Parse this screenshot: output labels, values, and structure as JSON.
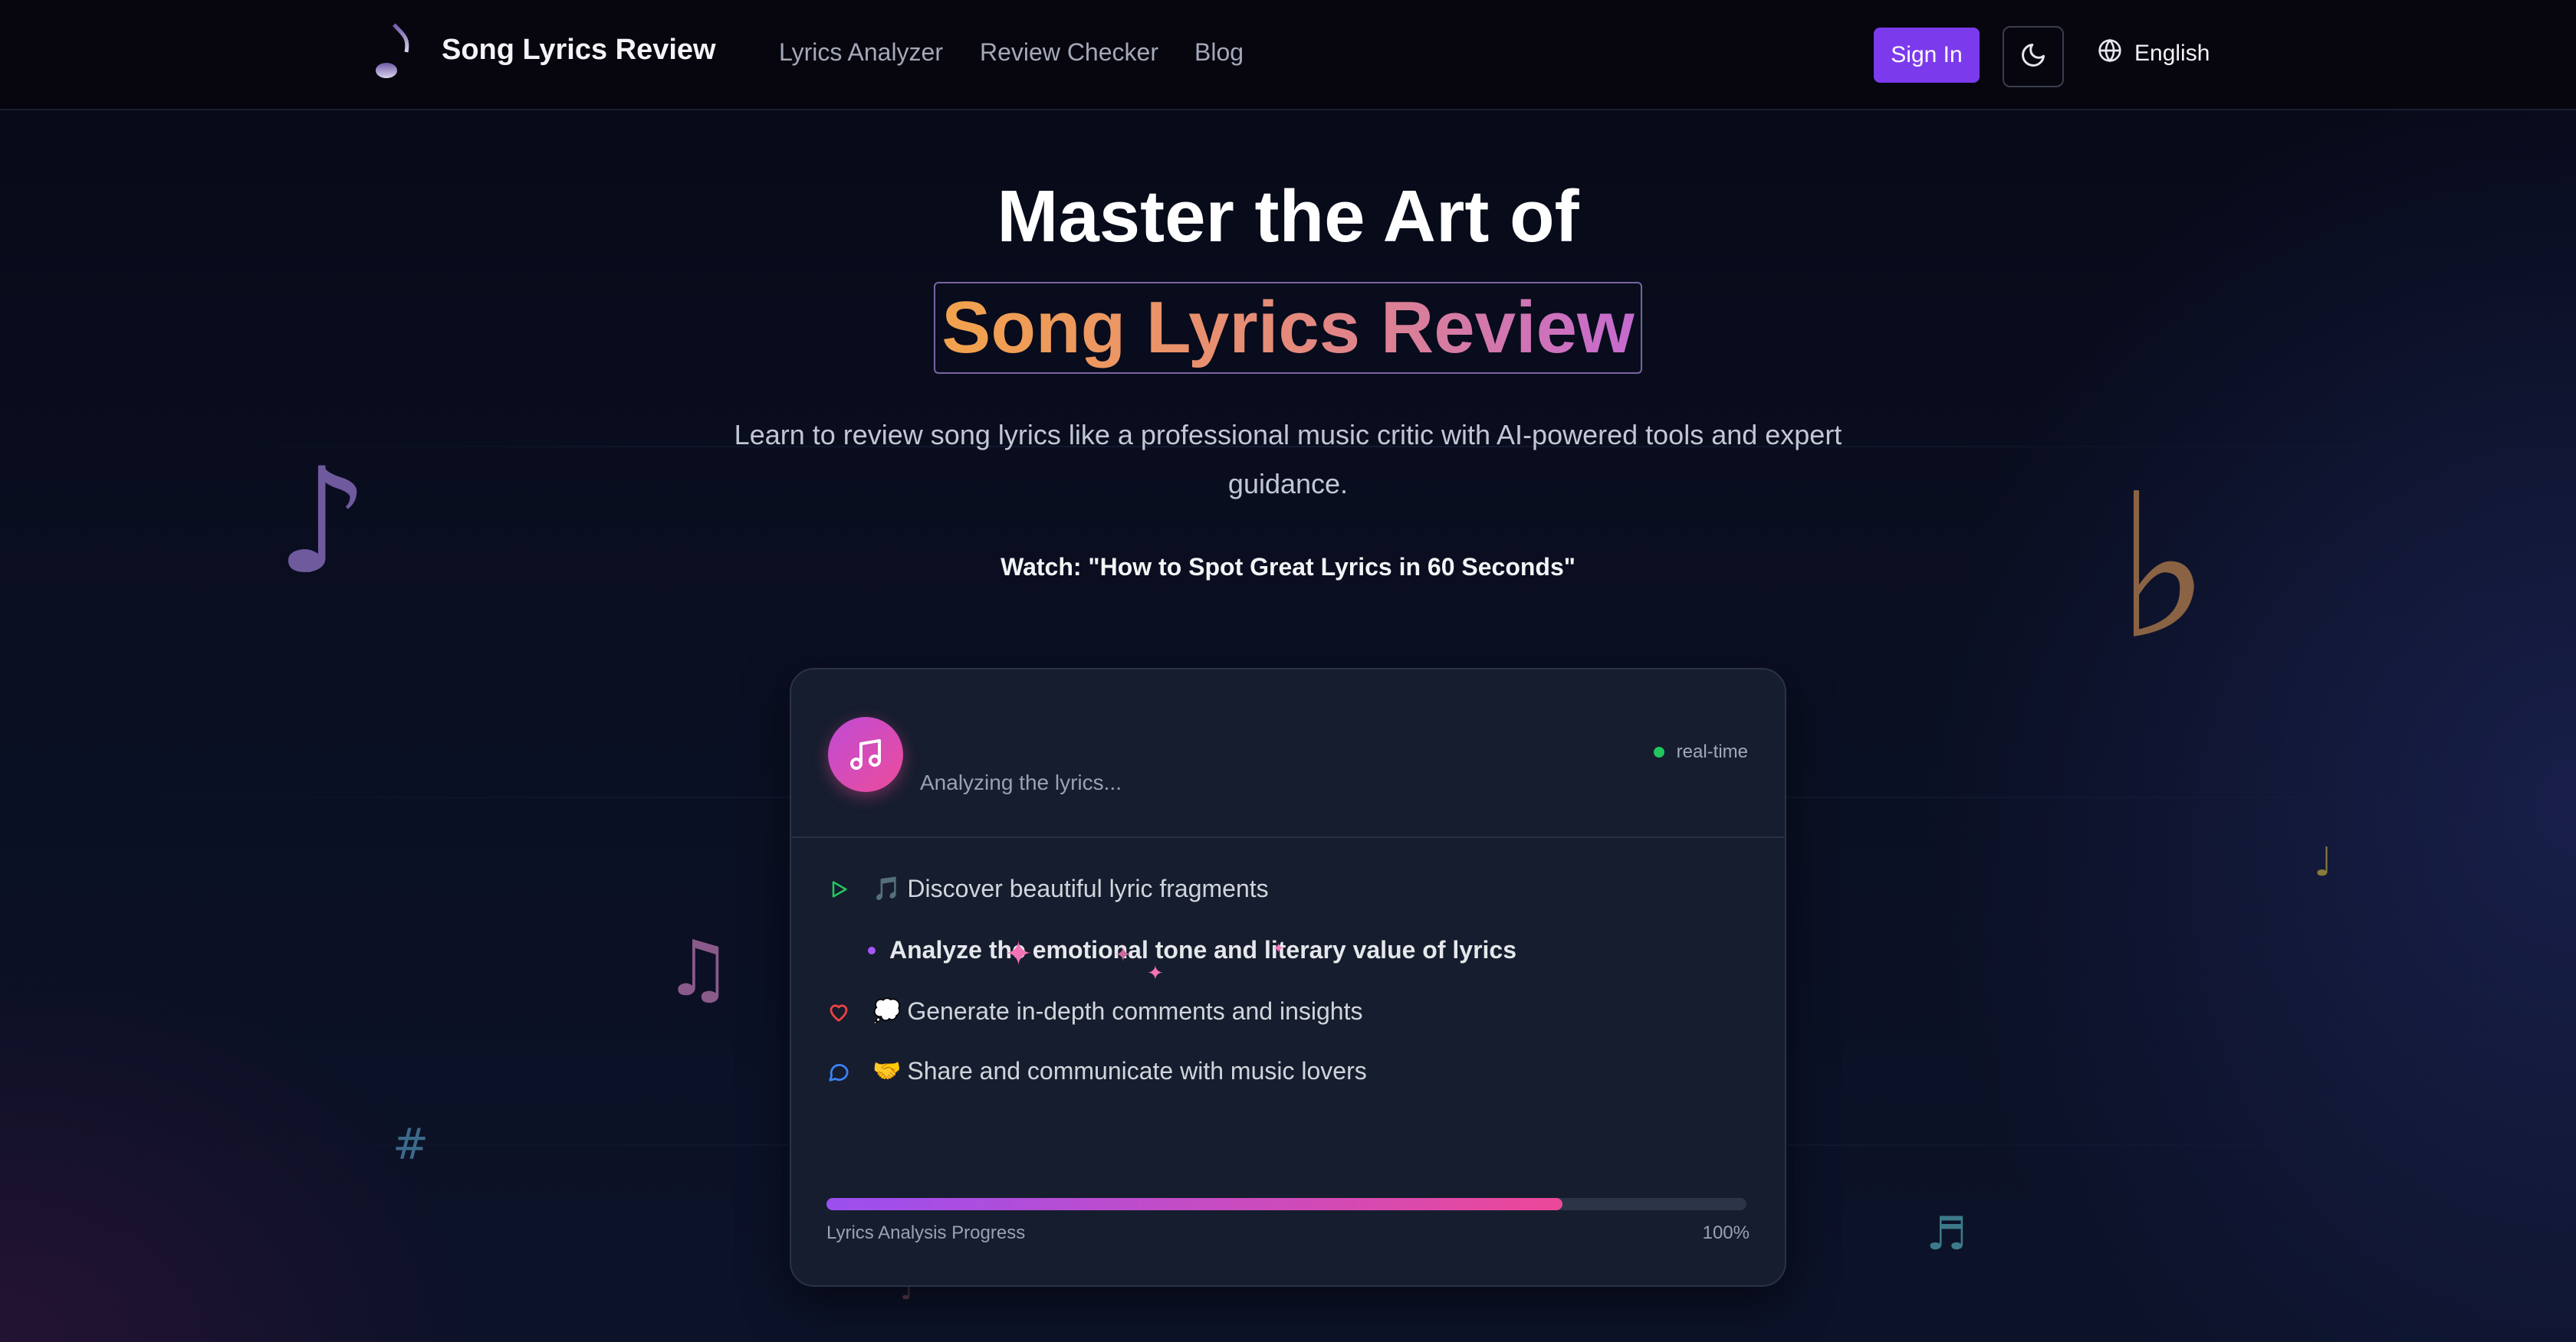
{
  "header": {
    "brand": "Song Lyrics Review",
    "nav": [
      "Lyrics Analyzer",
      "Review Checker",
      "Blog"
    ],
    "sign_in": "Sign In",
    "language": "English",
    "icons": {
      "logo": "music-note-icon",
      "theme": "moon-icon",
      "language": "globe-icon"
    }
  },
  "hero": {
    "line1": "Master the Art of",
    "line2": "Song Lyrics Review",
    "subtitle": "Learn to review song lyrics like a professional music critic with AI-powered tools and expert guidance.",
    "watch": "Watch: \"How to Spot Great Lyrics in 60 Seconds\""
  },
  "card": {
    "status": "Analyzing the lyrics...",
    "realtime": "real-time",
    "steps": [
      {
        "icon": "play-icon",
        "emoji": "🎵",
        "text": "Discover beautiful lyric fragments"
      },
      {
        "icon": "bullet",
        "emoji": "",
        "text": "Analyze the emotional tone and literary value of lyrics"
      },
      {
        "icon": "heart-icon",
        "emoji": "💭",
        "text": "Generate in-depth comments and insights"
      },
      {
        "icon": "chat-icon",
        "emoji": "🤝",
        "text": "Share and communicate with music lovers"
      }
    ],
    "progress_label": "Lyrics Analysis Progress",
    "progress_value": "100%",
    "progress_fraction": 0.8
  },
  "decor": {
    "notes": [
      "♪",
      "♭",
      "♩",
      "♫",
      "#",
      "♬",
      "♪"
    ]
  },
  "colors": {
    "accent": "#7c3aed",
    "brand_gradient_start": "#f2a24c",
    "brand_gradient_end": "#c56ad0",
    "live_dot": "#22c55e"
  }
}
